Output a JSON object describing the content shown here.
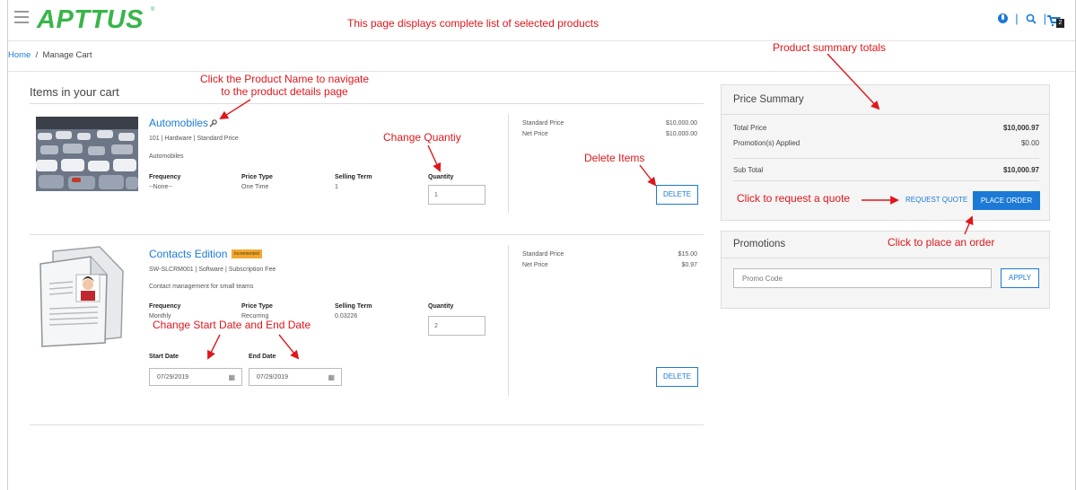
{
  "header": {
    "logo": "APTTUS",
    "logo_tm": "®",
    "cart_count": "2",
    "icons": [
      "menu-icon",
      "globe-icon",
      "search-icon",
      "cart-icon"
    ]
  },
  "breadcrumb": {
    "home": "Home",
    "separator": "/",
    "current": "Manage Cart"
  },
  "cart": {
    "title": "Items in your cart",
    "items": [
      {
        "name": "Automobiles",
        "subtitle": "101 | Hardware | Standard Price",
        "description": "Automobiles",
        "frequency_label": "Frequency",
        "frequency": "--None--",
        "price_type_label": "Price Type",
        "price_type": "One Time",
        "selling_term_label": "Selling Term",
        "selling_term": "1",
        "quantity_label": "Quantity",
        "quantity": "1",
        "standard_price_label": "Standard Price",
        "standard_price": "$10,000.00",
        "net_price_label": "Net Price",
        "net_price": "$10,000.00",
        "delete_label": "DELETE"
      },
      {
        "name": "Contacts Edition",
        "badge": "Incremented",
        "subtitle": "SW-SLCRM001 | Software | Subscription Fee",
        "description": "Contact management for small teams",
        "frequency_label": "Frequency",
        "frequency": "Monthly",
        "price_type_label": "Price Type",
        "price_type": "Recurring",
        "selling_term_label": "Selling Term",
        "selling_term": "0.03226",
        "quantity_label": "Quantity",
        "quantity": "2",
        "start_date_label": "Start Date",
        "start_date": "07/29/2019",
        "end_date_label": "End Date",
        "end_date": "07/29/2019",
        "standard_price_label": "Standard Price",
        "standard_price": "$15.00",
        "net_price_label": "Net Price",
        "net_price": "$0.97",
        "delete_label": "DELETE"
      }
    ]
  },
  "price_summary": {
    "title": "Price Summary",
    "total_price_label": "Total Price",
    "total_price": "$10,000.97",
    "promotions_label": "Promotion(s) Applied",
    "promotions": "$0.00",
    "subtotal_label": "Sub Total",
    "subtotal": "$10,000.97",
    "request_quote_label": "REQUEST QUOTE",
    "place_order_label": "PLACE ORDER"
  },
  "promotions": {
    "title": "Promotions",
    "placeholder": "Promo Code",
    "apply_label": "APPLY"
  },
  "annotations": {
    "page_desc": "This page displays complete list of selected products",
    "summary_totals": "Product summary totals",
    "product_name_1": "Click the Product Name to navigate",
    "product_name_2": "to the product details page",
    "change_quantity": "Change Quantiy",
    "delete_items": "Delete Items",
    "request_quote": "Click to request a quote",
    "place_order": "Click to place an order",
    "change_dates": "Change Start Date and End Date"
  },
  "colors": {
    "brand_green": "#39b54a",
    "link_blue": "#1c7ad6",
    "annotation_red": "#e0161b",
    "badge_orange": "#f0a830"
  }
}
